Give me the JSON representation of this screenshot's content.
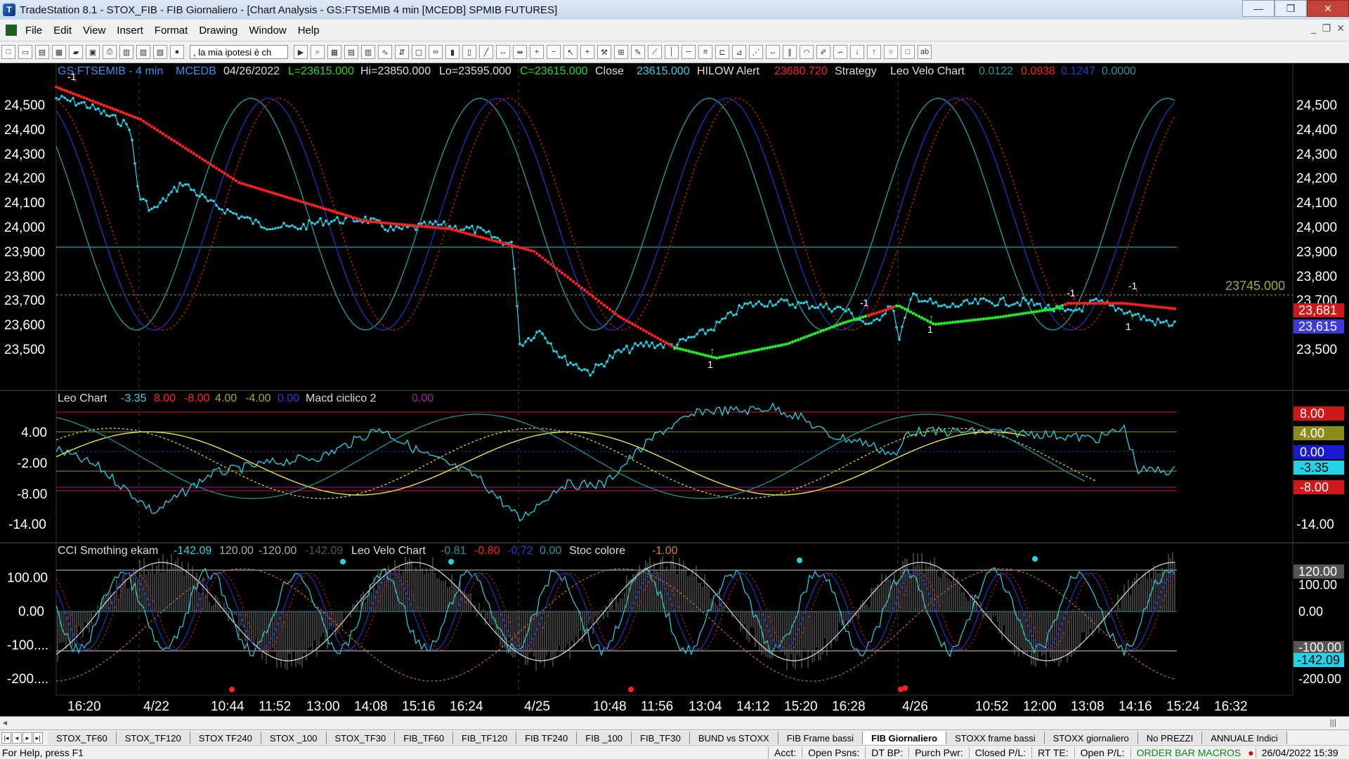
{
  "window": {
    "title": "TradeStation 8.1 - STOX_FIB - FIB Giornaliero - [Chart Analysis - GS:FTSEMIB  4 min  [MCEDB] SPMIB FUTURES]",
    "min": "—",
    "max": "❐",
    "close": "✕"
  },
  "menu": [
    "File",
    "Edit",
    "View",
    "Insert",
    "Format",
    "Drawing",
    "Window",
    "Help"
  ],
  "toolbar": {
    "combo_text": ", la mia ipotesi è ch"
  },
  "header": {
    "symbol": "GS:FTSEMIB - 4 min",
    "feed": "MCEDB",
    "date": "04/26/2022",
    "last": "L=23615.000",
    "hi": "Hi=23850.000",
    "lo": "Lo=23595.000",
    "close_eq": "C=23615.000",
    "close_lbl": "Close",
    "close_val": "23615.000",
    "hilow": "HILOW Alert",
    "hilow_val": "23680.720",
    "strategy": "Strategy",
    "leovelo": "Leo Velo Chart",
    "v1": "0.0122",
    "v2": "0.0938",
    "v3": "0.1247",
    "v4": "0.0000"
  },
  "panel2_header": {
    "name": "Leo Chart",
    "a": "-3.35",
    "b": "8.00",
    "c": "-8.00",
    "d": "4.00",
    "e": "-4.00",
    "f": "0.00",
    "macd": "Macd ciclico 2",
    "macd_v": "0.00"
  },
  "panel3_header": {
    "name": "CCI Smothing ekam",
    "a": "-142.09",
    "b": "120.00",
    "c": "-120.00",
    "d": "-142.09",
    "velo": "Leo Velo Chart",
    "e": "-0.81",
    "f": "-0.80",
    "g": "-0.72",
    "h": "0.00",
    "stoc": "Stoc colore",
    "i": "-1.00"
  },
  "price_axis": [
    "24,500",
    "24,400",
    "24,300",
    "24,200",
    "24,100",
    "24,000",
    "23,900",
    "23,800",
    "23,700",
    "23,600",
    "23,500"
  ],
  "price_tags": {
    "level": "23745.000",
    "red": "23,681",
    "blue": "23,615"
  },
  "panel2_axis": [
    "4.00",
    "-2.00",
    "-8.00",
    "-14.00"
  ],
  "panel2_tags": [
    "8.00",
    "4.00",
    "0.00",
    "-3.35",
    "-8.00",
    "-14.00"
  ],
  "panel3_axis": [
    "100.00",
    "0.00",
    "-100....",
    "-200...."
  ],
  "panel3_tags": [
    "120.00",
    "0.00",
    "-142.09",
    "-200.00",
    "100.00",
    "-100.00"
  ],
  "time_axis": [
    "16:20",
    "4/22",
    "10:44",
    "11:52",
    "13:00",
    "14:08",
    "15:16",
    "16:24",
    "4/25",
    "10:48",
    "11:56",
    "13:04",
    "14:12",
    "15:20",
    "16:28",
    "4/26",
    "10:52",
    "12:00",
    "13:08",
    "14:16",
    "15:24",
    "16:32"
  ],
  "markers": {
    "minus_one": "-1",
    "one": "1"
  },
  "colors": {
    "price": "#23d4e8",
    "falling_ma": "#ff2020",
    "rising_ma": "#22ee22",
    "cycle_blue": "#2030b0",
    "cycle_red": "#c01818",
    "cycle_teal": "#1a9a9a",
    "yellow": "#e6e64a"
  },
  "sheet_tabs": [
    "STOX_TF60",
    "STOX_TF120",
    "STOX TF240",
    "STOX _100",
    "STOX_TF30",
    "FIB_TF60",
    "FIB_TF120",
    "FIB TF240",
    "FIB _100",
    "FIB_TF30",
    "BUND vs STOXX",
    "FIB Frame bassi",
    "FIB Giornaliero",
    "STOXX frame bassi",
    "STOXX giornaliero",
    "No PREZZI",
    "ANNUALE Indici"
  ],
  "active_tab": "FIB Giornaliero",
  "status": {
    "help": "For Help, press F1",
    "acct": "Acct:",
    "open_psns": "Open Psns:",
    "dt_bp": "DT BP:",
    "purch": "Purch Pwr:",
    "closed": "Closed P/L:",
    "rt_te": "RT TE:",
    "open_pl": "Open P/L:",
    "macros": "ORDER BAR  MACROS",
    "datetime": "26/04/2022 15:39"
  }
}
